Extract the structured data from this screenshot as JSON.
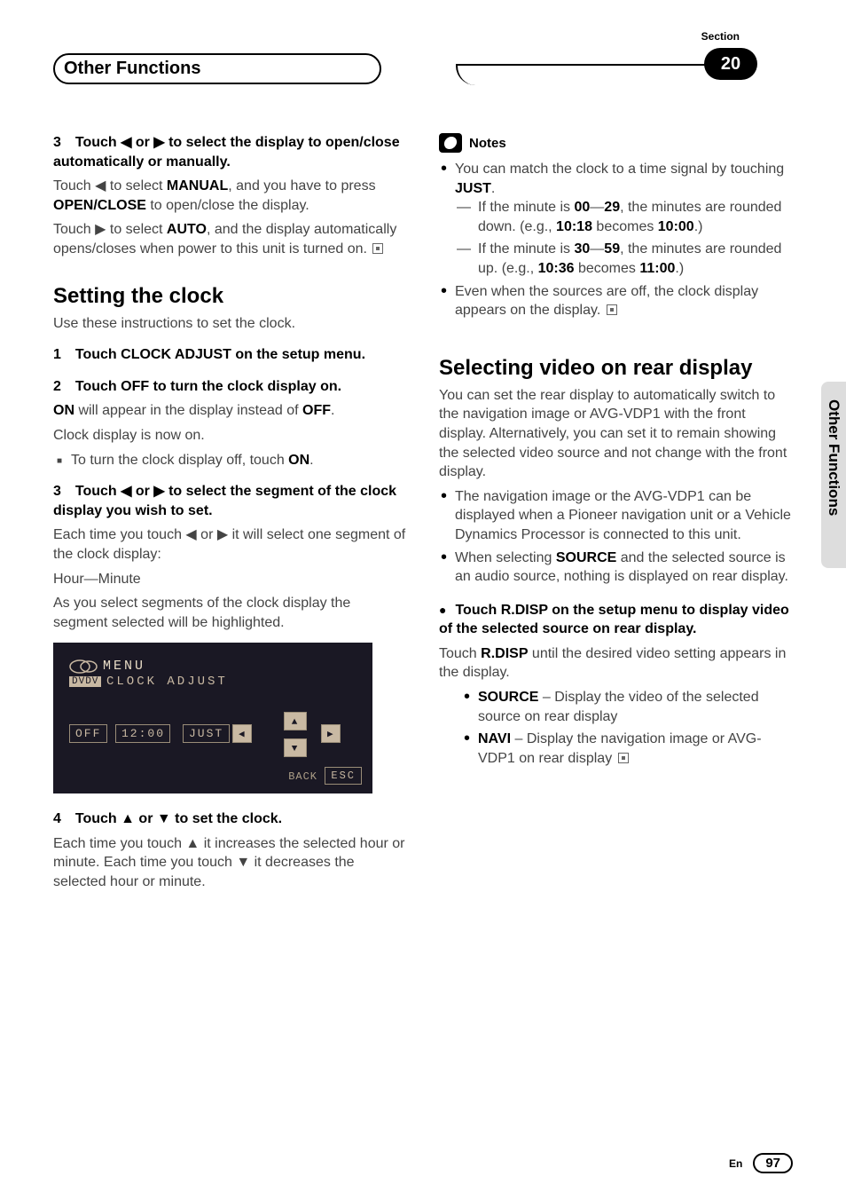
{
  "header": {
    "title": "Other Functions",
    "section_label": "Section",
    "section_number": "20"
  },
  "sidebar_label": "Other Functions",
  "left": {
    "step3": {
      "head": "3 Touch ◀ or ▶ to select the display to open/close automatically or manually.",
      "l1a": "Touch ◀ to select ",
      "l1b": "MANUAL",
      "l1c": ", and you have to press ",
      "l1d": "OPEN/CLOSE",
      "l1e": " to open/close the display.",
      "l2a": "Touch ▶ to select ",
      "l2b": "AUTO",
      "l2c": ", and the display automatically opens/closes when power to this unit is turned on."
    },
    "h2_clock": "Setting the clock",
    "clock_intro": "Use these instructions to set the clock.",
    "clock1_head": "1 Touch CLOCK ADJUST on the setup menu.",
    "clock2": {
      "head": "2 Touch OFF to turn the clock display on.",
      "l1a": "ON",
      "l1b": " will appear in the display instead of ",
      "l1c": "OFF",
      "l1d": ".",
      "l2": "Clock display is now on.",
      "bullet_a": "To turn the clock display off, touch ",
      "bullet_b": "ON",
      "bullet_c": "."
    },
    "clock3": {
      "head": "3 Touch ◀ or ▶ to select the segment of the clock display you wish to set.",
      "l1": "Each time you touch ◀ or ▶ it will select one segment of the clock display:",
      "l2": "Hour—Minute",
      "l3": "As you select segments of the clock display the segment selected will be highlighted."
    },
    "lcd": {
      "menu": "MENU",
      "dvdv": "DVDV",
      "sub": "CLOCK ADJUST",
      "off": "OFF",
      "time": "12:00",
      "just": "JUST",
      "back": "BACK",
      "esc": "ESC"
    },
    "clock4": {
      "head": "4 Touch ▲ or ▼ to set the clock.",
      "l1": "Each time you touch ▲ it increases the selected hour or minute. Each time you touch ▼ it decreases the selected hour or minute."
    }
  },
  "right": {
    "notes_label": "Notes",
    "n1a": "You can match the clock to a time signal by touching ",
    "n1b": "JUST",
    "n1c": ".",
    "n1d1a": "If the minute is ",
    "n1d1b": "00",
    "n1d1c": "—",
    "n1d1d": "29",
    "n1d1e": ", the minutes are rounded down. (e.g., ",
    "n1d1f": "10:18",
    "n1d1g": " becomes ",
    "n1d1h": "10:00",
    "n1d1i": ".)",
    "n1d2a": "If the minute is ",
    "n1d2b": "30",
    "n1d2c": "—",
    "n1d2d": "59",
    "n1d2e": ", the minutes are rounded up. (e.g., ",
    "n1d2f": "10:36",
    "n1d2g": " becomes ",
    "n1d2h": "11:00",
    "n1d2i": ".)",
    "n2": "Even when the sources are off, the clock display appears on the display.",
    "h2_rear": "Selecting video on rear display",
    "rear_intro": "You can set the rear display to automatically switch to the navigation image or AVG-VDP1 with the front display. Alternatively, you can set it to remain showing the selected video source and not change with the front display.",
    "rear_b1": "The navigation image or the AVG-VDP1 can be displayed when a Pioneer navigation unit or a Vehicle Dynamics Processor is connected to this unit.",
    "rear_b2a": "When selecting ",
    "rear_b2b": "SOURCE",
    "rear_b2c": " and the selected source is an audio source, nothing is displayed on rear display.",
    "rear_step_head": "Touch R.DISP on the setup menu to display video of the selected source on rear display.",
    "rear_step_l1a": "Touch ",
    "rear_step_l1b": "R.DISP",
    "rear_step_l1c": " until the desired video setting appears in the display.",
    "rear_opt1a": "SOURCE",
    "rear_opt1b": " – Display the video of the selected source on rear display",
    "rear_opt2a": "NAVI",
    "rear_opt2b": " – Display the navigation image or AVG-VDP1 on rear display"
  },
  "footer": {
    "lang": "En",
    "page": "97"
  }
}
